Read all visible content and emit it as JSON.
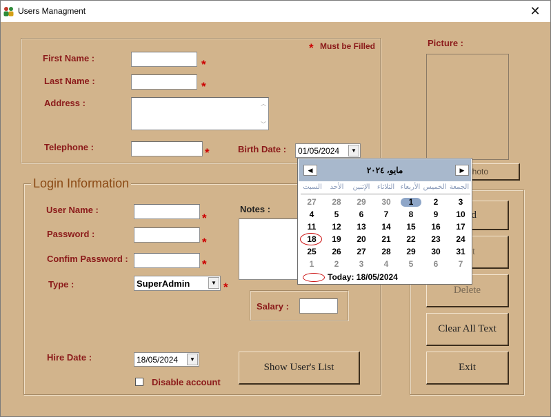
{
  "window": {
    "title": "Users Managment",
    "close_glyph": "✕",
    "icon": "users-app-icon"
  },
  "personal": {
    "must_filled_star": "*",
    "must_filled": "Must be Filled",
    "first_name_label": "First Name :",
    "last_name_label": "Last Name :",
    "address_label": "Address :",
    "telephone_label": "Telephone :",
    "birth_date_label": "Birth Date :",
    "birth_date_value": "01/05/2024",
    "first_name_value": "",
    "last_name_value": "",
    "address_value": "",
    "telephone_value": ""
  },
  "picture": {
    "label": "Picture :",
    "photo_button": "Photo"
  },
  "login": {
    "legend": "Login Information",
    "user_name_label": "User Name :",
    "password_label": "Password :",
    "confirm_password_label": "Confim Password :",
    "type_label": "Type :",
    "type_value": "SuperAdmin",
    "notes_label": "Notes :",
    "salary_label": "Salary :",
    "hire_date_label": "Hire Date :",
    "hire_date_value": "18/05/2024",
    "disable_account_label": "Disable account",
    "show_users_button": "Show User's List"
  },
  "actions": {
    "add_label_partial": "d",
    "edit_label_partial": "t",
    "delete_label": "Delete",
    "clear_label": "Clear All Text",
    "exit_label": "Exit"
  },
  "calendar": {
    "month_title": "مايو، ٢٠٢٤",
    "prev_glyph": "◀",
    "next_glyph": "▶",
    "weekdays": [
      "السبت",
      "الأحد",
      "الإثنين",
      "الثلاثاء",
      "الأربعاء",
      "الخميس",
      "الجمعة"
    ],
    "weeks": [
      [
        "27",
        "28",
        "29",
        "30",
        "1",
        "2",
        "3"
      ],
      [
        "4",
        "5",
        "6",
        "7",
        "8",
        "9",
        "10"
      ],
      [
        "11",
        "12",
        "13",
        "14",
        "15",
        "16",
        "17"
      ],
      [
        "18",
        "19",
        "20",
        "21",
        "22",
        "23",
        "24"
      ],
      [
        "25",
        "26",
        "27",
        "28",
        "29",
        "30",
        "31"
      ],
      [
        "1",
        "2",
        "3",
        "4",
        "5",
        "6",
        "7"
      ]
    ],
    "other_month": [
      [
        0,
        0
      ],
      [
        0,
        1
      ],
      [
        0,
        2
      ],
      [
        0,
        3
      ],
      [
        5,
        0
      ],
      [
        5,
        1
      ],
      [
        5,
        2
      ],
      [
        5,
        3
      ],
      [
        5,
        4
      ],
      [
        5,
        5
      ],
      [
        5,
        6
      ]
    ],
    "selected": [
      0,
      4
    ],
    "today": [
      3,
      0
    ],
    "today_text": "Today: 18/05/2024"
  }
}
